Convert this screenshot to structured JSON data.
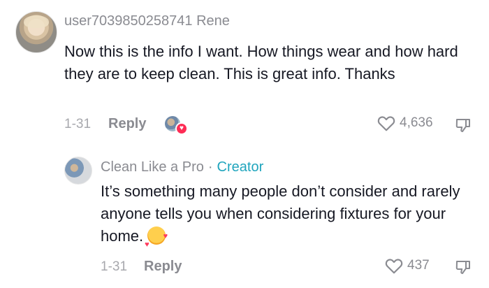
{
  "comment": {
    "username": "user7039850258741 Rene",
    "text": "Now this is the info I want. How things wear and how hard they are to keep clean. This is great info. Thanks",
    "date": "1-31",
    "reply_label": "Reply",
    "like_count": "4,636"
  },
  "reply": {
    "name": "Clean Like a Pro",
    "separator": "·",
    "creator_label": "Creator",
    "text": "It’s something many people don’t consider and rarely anyone tells you when considering fixtures for your home.",
    "date": "1-31",
    "reply_label": "Reply",
    "like_count": "437"
  },
  "icons": {
    "heart": "heart-outline-icon",
    "dislike": "thumbs-down-icon",
    "emoji": "smiling-face-with-hearts-emoji-icon"
  },
  "colors": {
    "text": "#161823",
    "secondary": "#8a8b91",
    "creator_accent": "#20a5bd",
    "heart_badge": "#fe2c55"
  }
}
